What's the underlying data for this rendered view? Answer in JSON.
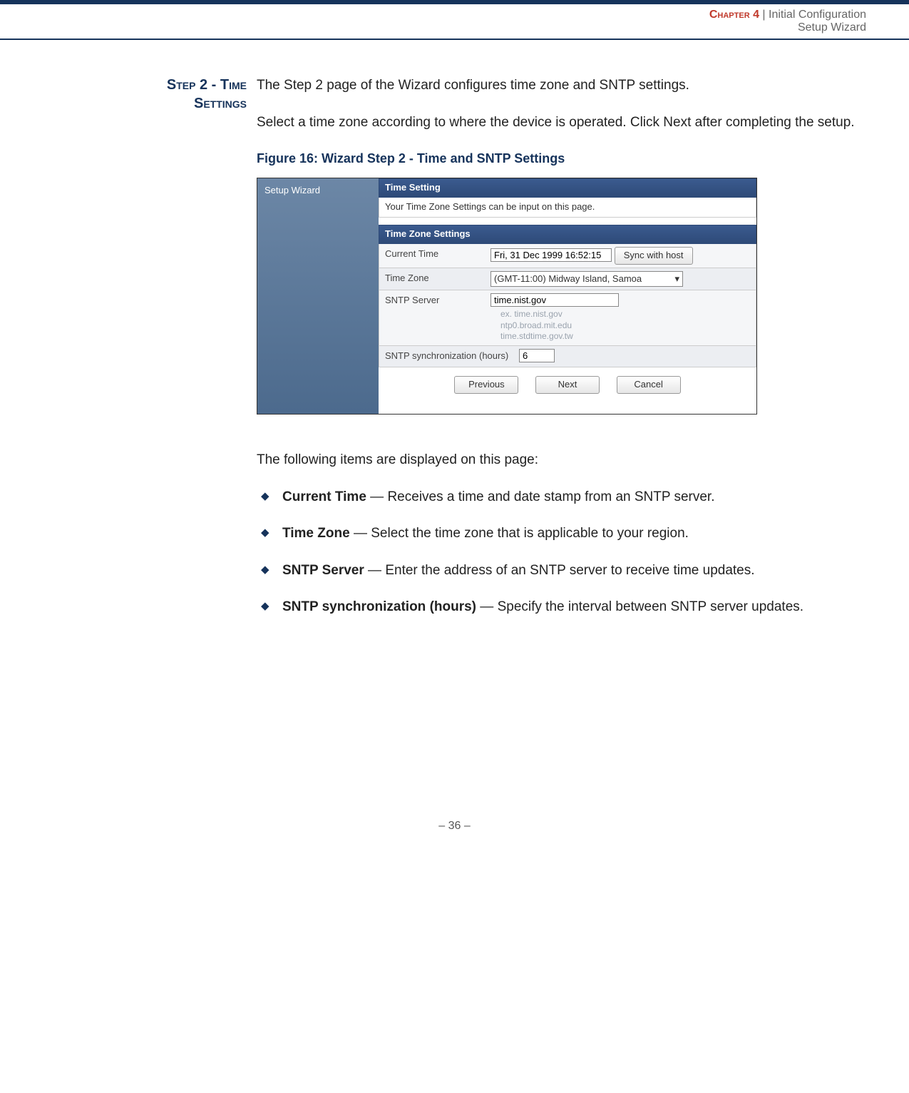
{
  "header": {
    "chapter_label": "Chapter 4",
    "sep": "  |  ",
    "title": "Initial Configuration",
    "subtitle": "Setup Wizard"
  },
  "side_heading_line1": "Step 2 - Time",
  "side_heading_line2": "Settings",
  "intro_p1": "The Step 2 page of the Wizard configures time zone and SNTP settings.",
  "intro_p2": "Select a time zone according to where the device is operated. Click Next after completing the setup.",
  "figure_caption": "Figure 16:  Wizard Step 2 - Time and SNTP Settings",
  "shot": {
    "left_title": "Setup Wizard",
    "section1_title": "Time Setting",
    "section1_desc": "Your Time Zone Settings can be input on this page.",
    "section2_title": "Time Zone Settings",
    "rows": {
      "current_time_label": "Current Time",
      "current_time_value": "Fri, 31 Dec 1999 16:52:15",
      "sync_btn": "Sync with host",
      "tz_label": "Time Zone",
      "tz_value": "(GMT-11:00) Midway Island, Samoa",
      "sntp_label": "SNTP Server",
      "sntp_value": "time.nist.gov",
      "sntp_hint1": "ex. time.nist.gov",
      "sntp_hint2": "ntp0.broad.mit.edu",
      "sntp_hint3": "time.stdtime.gov.tw",
      "sync_hours_label": "SNTP synchronization (hours)",
      "sync_hours_value": "6"
    },
    "buttons": {
      "prev": "Previous",
      "next": "Next",
      "cancel": "Cancel"
    }
  },
  "post_text": "The following items are displayed on this page:",
  "bullets": [
    {
      "term": "Current Time",
      "desc": " — Receives a time and date stamp from an SNTP server."
    },
    {
      "term": "Time Zone",
      "desc": " —  Select the time zone that is applicable to your region."
    },
    {
      "term": "SNTP Server",
      "desc": " — Enter the address of an SNTP server to receive time updates."
    },
    {
      "term": "SNTP synchronization (hours)",
      "desc": " — Specify the interval between SNTP server updates."
    }
  ],
  "page_number": "–  36  –"
}
